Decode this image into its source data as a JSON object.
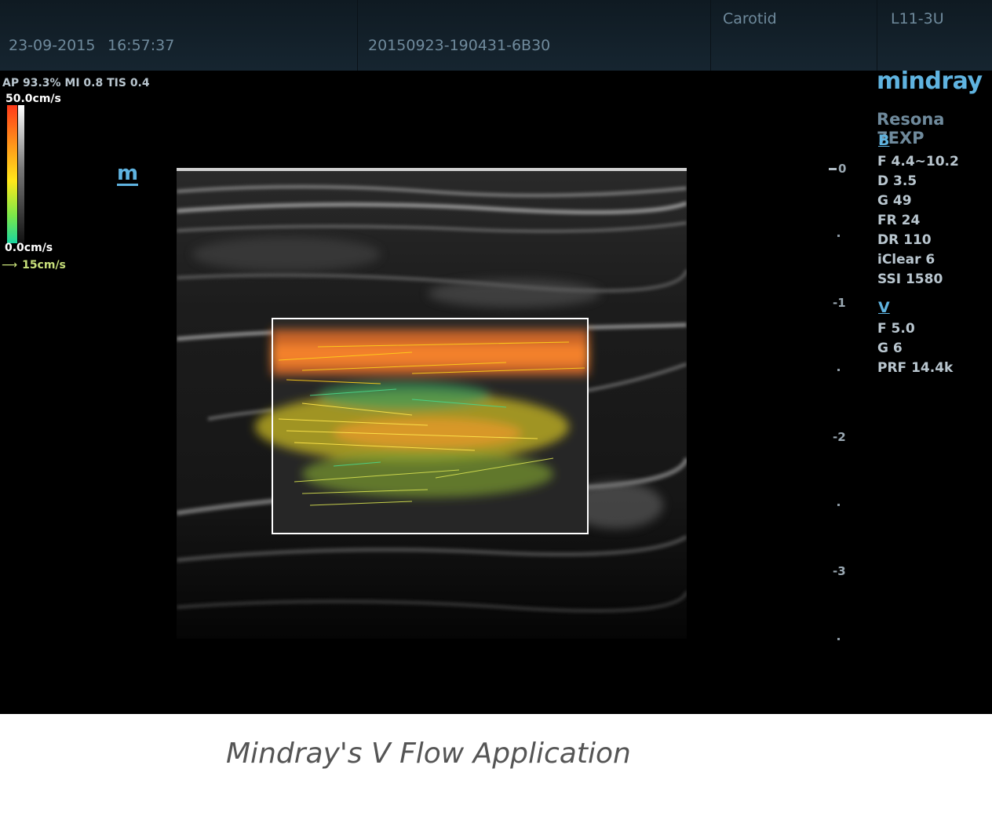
{
  "header": {
    "date": "23-09-2015",
    "time": "16:57:37",
    "patient_id": "20150923-190431-6B30",
    "exam_preset": "Carotid",
    "probe": "L11-3U"
  },
  "acoustic": {
    "text": "AP 93.3%  MI 0.8 TIS 0.4"
  },
  "color_scale": {
    "max_label": "50.0cm/s",
    "min_label": "0.0cm/s",
    "reference_arrow_label": "15cm/s",
    "colors": [
      "#ff3a1a",
      "#ff9a1a",
      "#ffe81a",
      "#7be84a",
      "#1ad6a0"
    ],
    "gray_colors": [
      "#ffffff",
      "#7a7a7a",
      "#111111"
    ]
  },
  "mode_icon": {
    "glyph": "m"
  },
  "depth_scale": {
    "labels": [
      "0",
      "-1",
      "-2",
      "-3"
    ]
  },
  "branding": {
    "brand": "mindray",
    "model": "Resona 7EXP"
  },
  "b_mode": {
    "title": "B",
    "params": [
      "F 4.4~10.2",
      "D 3.5",
      "G 49",
      "FR 24",
      "DR 110",
      "iClear 6",
      "SSI 1580"
    ]
  },
  "v_mode": {
    "title": "V",
    "params": [
      "F 5.0",
      "G 6",
      "PRF 14.4k"
    ]
  },
  "caption": "Mindray's V Flow Application",
  "colors": {
    "accent": "#5fb3e0",
    "header_text": "#6f8a9c",
    "roi_border": "#ffffff"
  }
}
